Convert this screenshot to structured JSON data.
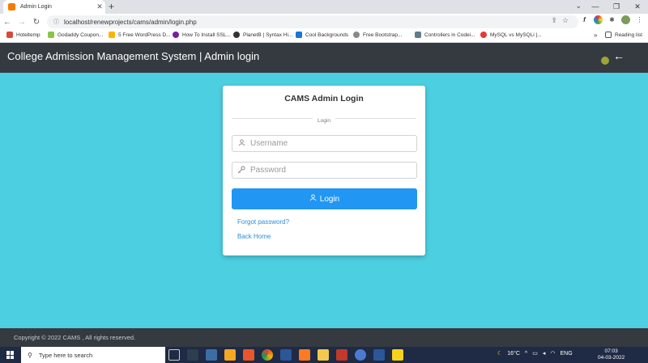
{
  "browser": {
    "tab_title": "Admin Login",
    "url": "localhost/renewprojects/cams/admin/login.php",
    "bookmarks": [
      "Hoteltemp",
      "Godaddy Coupon...",
      "5 Free WordPress D...",
      "How To Install SSL...",
      "PlanetB | Syntax Hi...",
      "Cool Backgrounds",
      "Free Bootstrap...",
      "Controllers in Codei...",
      "MySQL vs MySQLi |..."
    ],
    "reading_list": "Reading list"
  },
  "header": {
    "title": "College Admission Management System | Admin login"
  },
  "login": {
    "card_title": "CAMS Admin Login",
    "divider_label": "Login",
    "username_placeholder": "Username",
    "password_placeholder": "Password",
    "button_label": "Login",
    "forgot_link": "Forgot password?",
    "back_link": "Back Home"
  },
  "footer": {
    "copyright": "Copyright © 2022 CAMS , All rights reserved."
  },
  "taskbar": {
    "search_placeholder": "Type here to search",
    "weather": "16°C",
    "language": "ENG",
    "time": "07:03",
    "date": "04-03-2022"
  },
  "colors": {
    "header_bg": "#343a40",
    "main_bg": "#4ccfe0",
    "primary_button": "#2196f3",
    "link": "#2a8fd6"
  }
}
